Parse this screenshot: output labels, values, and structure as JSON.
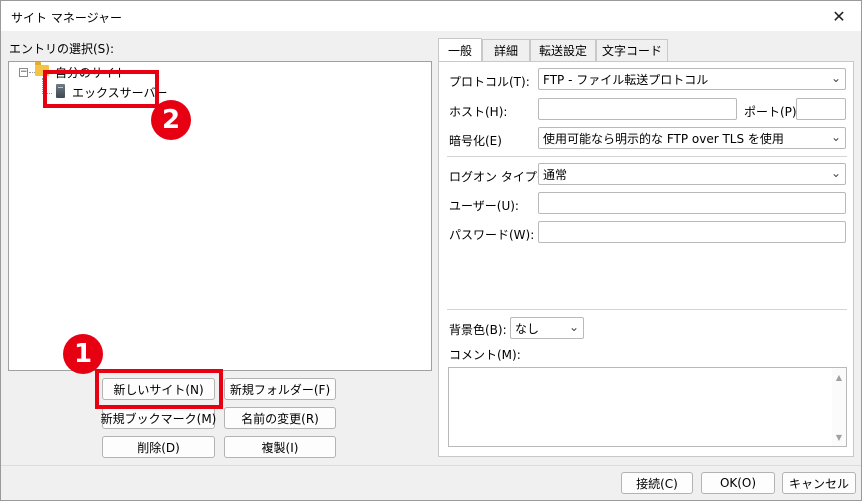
{
  "window": {
    "title": "サイト マネージャー",
    "close_glyph": "✕"
  },
  "left": {
    "select_label": "エントリの選択(S):",
    "tree": {
      "expander": "−",
      "root": "自分のサイト",
      "child": "エックスサーバー"
    },
    "buttons": {
      "new_site": "新しいサイト(N)",
      "new_folder": "新規フォルダー(F)",
      "new_bookmark": "新規ブックマーク(M)",
      "rename": "名前の変更(R)",
      "delete": "削除(D)",
      "duplicate": "複製(I)"
    }
  },
  "annotations": {
    "badge1": "1",
    "badge2": "2",
    "highlight_color": "#e60012"
  },
  "tabs": [
    "一般",
    "詳細",
    "転送設定",
    "文字コード"
  ],
  "general": {
    "protocol_label": "プロトコル(T):",
    "protocol_value": "FTP - ファイル転送プロトコル",
    "host_label": "ホスト(H):",
    "host_value": "",
    "port_label": "ポート(P):",
    "port_value": "",
    "encryption_label": "暗号化(E)",
    "encryption_value": "使用可能なら明示的な FTP over TLS を使用",
    "logon_type_label": "ログオン タイプ(L):",
    "logon_type_value": "通常",
    "user_label": "ユーザー(U):",
    "user_value": "",
    "password_label": "パスワード(W):",
    "password_value": "",
    "bg_color_label": "背景色(B):",
    "bg_color_value": "なし",
    "comment_label": "コメント(M):",
    "comment_value": ""
  },
  "footer": {
    "connect": "接続(C)",
    "ok": "OK(O)",
    "cancel": "キャンセル"
  },
  "icons": {
    "dropdown": "chevron-down-icon",
    "scroll_up": "▲",
    "scroll_down": "▼"
  }
}
